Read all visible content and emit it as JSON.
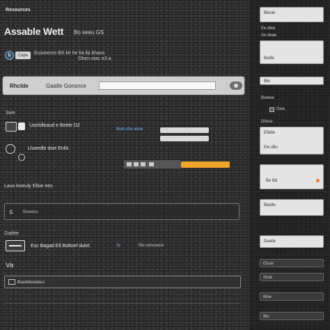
{
  "header": {
    "top_label": "Resources",
    "title": "Assable Wett",
    "subtitle": "Bo seeu GS"
  },
  "info": {
    "badge": "b",
    "tag": "Cape",
    "line1": "Eusioeces BS  ke he lia lla bhaos",
    "line2": "Ohen eiac e3 a"
  },
  "toolbar": {
    "title": "Rhclde",
    "label": "Gaalte Gonsnce",
    "input_placeholder": ""
  },
  "section1": {
    "label": "Swe",
    "row1_text": "Uselvlleaud e Beele  D2",
    "row1_link": "Bsdl eSe ieloe",
    "row2_text": "Llueedle dsie Enlls",
    "progress": 0.46
  },
  "section2": {
    "label": "Laus loseuly Ellue ees",
    "field_icon": "≤",
    "field_placeholder": "Boeeles"
  },
  "section3": {
    "label": "Gadee",
    "row_text": "Ess Bagad Ell Boltoef dulel:",
    "row_link": "lo",
    "row_note": "Ble eelsoedel",
    "va_label": "Va",
    "field_text": "Bsedoleoalecs"
  },
  "right_panel": {
    "items": [
      {
        "label": "Blesle"
      },
      {
        "label": "Ee dlee"
      },
      {
        "label": "Se deae"
      },
      {
        "label": "Bellle"
      },
      {
        "label": "Ble"
      },
      {
        "label": "Boleoe"
      },
      {
        "label": "Dllose"
      },
      {
        "label": "Ellelle"
      },
      {
        "label": "Ele dllo"
      },
      {
        "label": "Be Bd"
      },
      {
        "label": "Bbelle"
      },
      {
        "label": "Deelle"
      },
      {
        "label": "Elsoe"
      },
      {
        "label": "Slole"
      },
      {
        "label": "Bloe"
      },
      {
        "label": "Blo"
      }
    ],
    "checkbox_label": "Dloe"
  },
  "colors": {
    "accent": "#f0a62a",
    "link": "#6fb4ff",
    "status_dot": "#f07a30"
  }
}
